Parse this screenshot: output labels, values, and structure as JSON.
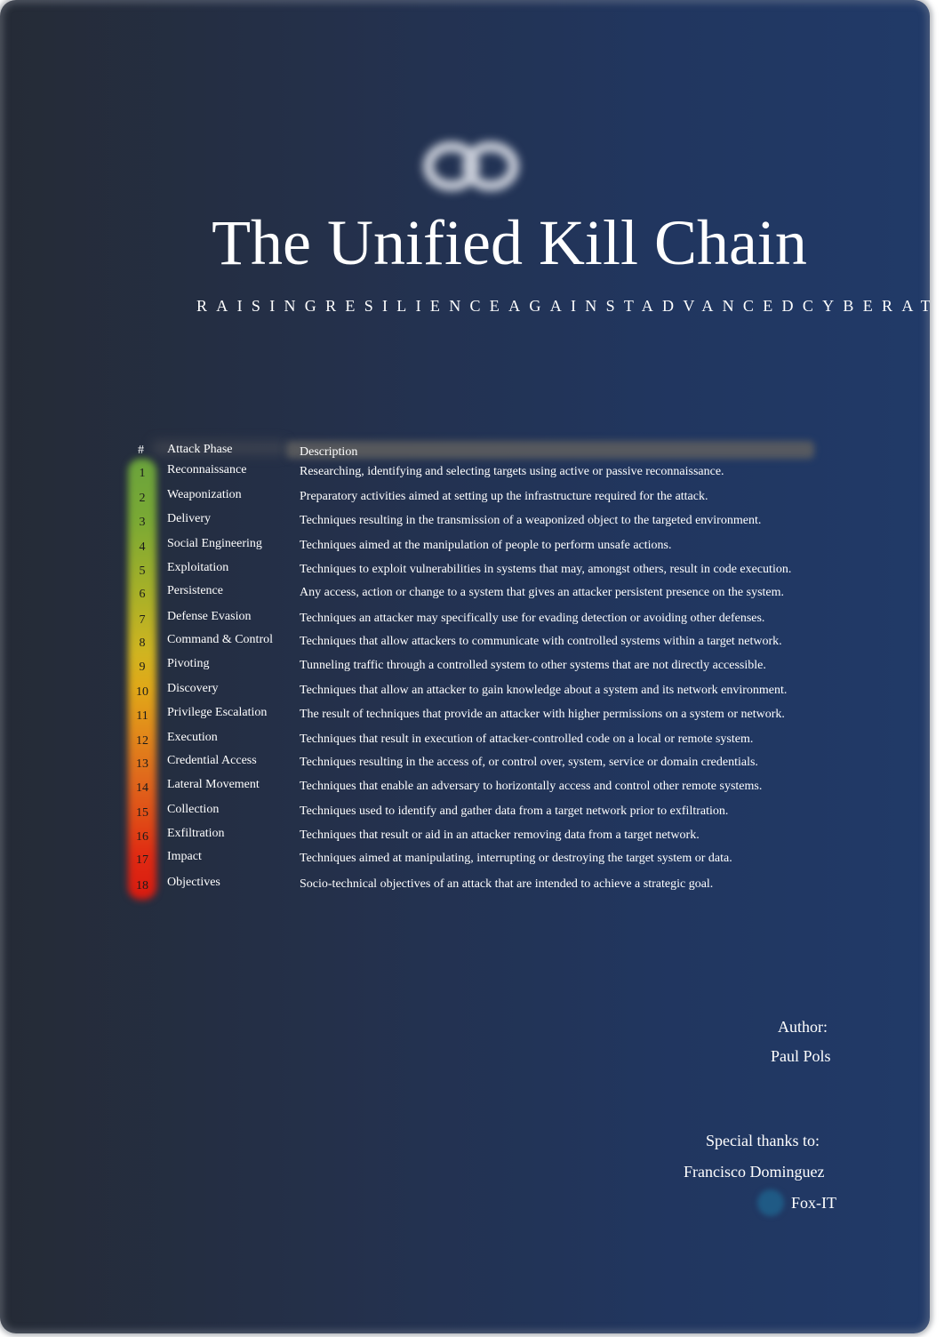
{
  "document": {
    "title": "The Unified Kill Chain",
    "subtitle": "RAISINGRESILIENCEAGAINSTADVANCEDCYBERATTACKS",
    "logo_icon": "chain-link-icon"
  },
  "table": {
    "headers": {
      "number": "#",
      "phase": "Attack Phase",
      "description": "Description"
    },
    "gradient_colors": [
      "#6aa33c",
      "#d0b420",
      "#e06a1c",
      "#d81a10"
    ],
    "rows": [
      {
        "num": "1",
        "phase": "Reconnaissance",
        "description": "Researching, identifying and selecting targets using active or passive reconnaissance."
      },
      {
        "num": "2",
        "phase": "Weaponization",
        "description": "Preparatory activities aimed at setting up the infrastructure required for the attack."
      },
      {
        "num": "3",
        "phase": "Delivery",
        "description": "Techniques resulting in the transmission of a weaponized object to the targeted environment."
      },
      {
        "num": "4",
        "phase": "Social Engineering",
        "description": "Techniques aimed at the manipulation of people to perform unsafe actions."
      },
      {
        "num": "5",
        "phase": "Exploitation",
        "description": "Techniques to exploit vulnerabilities in systems that may, amongst others, result in code execution."
      },
      {
        "num": "6",
        "phase": "Persistence",
        "description": "Any access, action or change to a system that gives an attacker persistent presence on the system."
      },
      {
        "num": "7",
        "phase": "Defense Evasion",
        "description": "Techniques an attacker may specifically use for evading detection or avoiding other defenses."
      },
      {
        "num": "8",
        "phase": "Command & Control",
        "description": "Techniques that allow attackers to communicate with controlled systems within a target network."
      },
      {
        "num": "9",
        "phase": "Pivoting",
        "description": "Tunneling traffic through a controlled system to other systems that are not directly accessible."
      },
      {
        "num": "10",
        "phase": "Discovery",
        "description": "Techniques that allow an attacker to gain knowledge about a system and its network environment."
      },
      {
        "num": "11",
        "phase": "Privilege Escalation",
        "description": "The result of techniques that provide an attacker with higher permissions on a system or network."
      },
      {
        "num": "12",
        "phase": "Execution",
        "description": "Techniques that result in execution of attacker-controlled code on a local or remote system."
      },
      {
        "num": "13",
        "phase": "Credential Access",
        "description": "Techniques resulting in the access of, or control over, system, service or domain credentials."
      },
      {
        "num": "14",
        "phase": "Lateral Movement",
        "description": "Techniques that enable an adversary to horizontally access and control other remote systems."
      },
      {
        "num": "15",
        "phase": "Collection",
        "description": "Techniques used to identify and gather data from a target network prior to exfiltration."
      },
      {
        "num": "16",
        "phase": "Exfiltration",
        "description": "Techniques that result or aid in an attacker removing data from a target network."
      },
      {
        "num": "17",
        "phase": "Impact",
        "description": "Techniques aimed at manipulating, interrupting or destroying the target system or data."
      },
      {
        "num": "18",
        "phase": "Objectives",
        "description": "Socio-technical objectives of an attack that are intended to achieve a strategic goal."
      }
    ]
  },
  "credits": {
    "author_label": "Author:",
    "author_name": "Paul Pols",
    "thanks_label": "Special thanks to:",
    "thanks_names": [
      "Francisco Dominguez",
      "Fox-IT"
    ],
    "foxit_logo_icon": "fox-it-logo-icon"
  }
}
